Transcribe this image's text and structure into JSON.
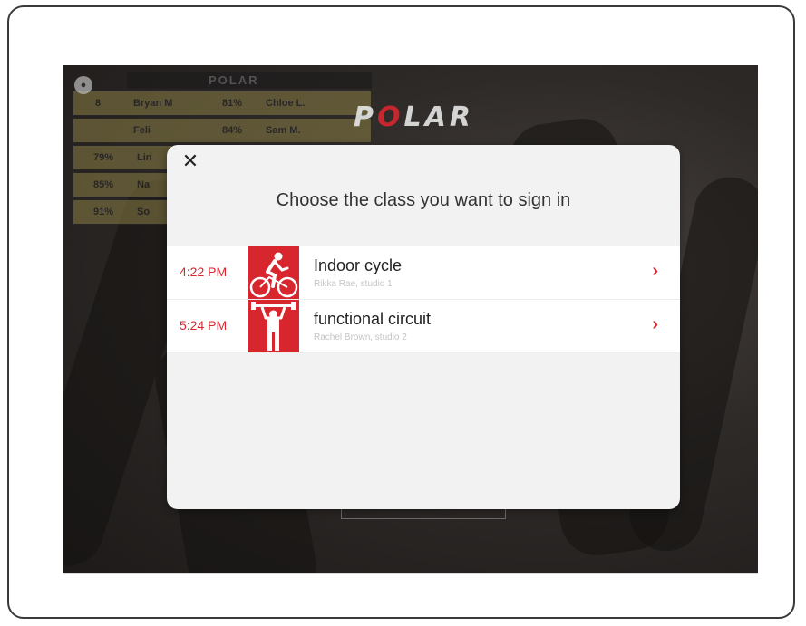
{
  "background": {
    "brand_logo": "POLAR",
    "leaderboard_header": "POLAR",
    "leaderboard_rows": [
      {
        "value": "8",
        "name": "Bryan M",
        "value2": "81%",
        "name2": "Chloe L."
      },
      {
        "value": "",
        "name": "Feli",
        "value2": "84%",
        "name2": "Sam M."
      },
      {
        "value": "79%",
        "name": "Lin",
        "value2": "",
        "name2": ""
      },
      {
        "value": "85%",
        "name": "Na",
        "value2": "",
        "name2": ""
      },
      {
        "value": "91%",
        "name": "So",
        "value2": "",
        "name2": ""
      }
    ]
  },
  "modal": {
    "close_icon": "✕",
    "title": "Choose the class you want to sign in",
    "classes": [
      {
        "time": "4:22 PM",
        "name": "Indoor cycle",
        "subtitle": "Rikka Rae, studio 1",
        "icon": "cycling-icon",
        "chevron": "›"
      },
      {
        "time": "5:24 PM",
        "name": "functional circuit",
        "subtitle": "Rachel Brown, studio 2",
        "icon": "weightlifting-icon",
        "chevron": "›"
      }
    ]
  },
  "colors": {
    "accent": "#d7262e",
    "modal_bg": "#f2f2f2"
  }
}
